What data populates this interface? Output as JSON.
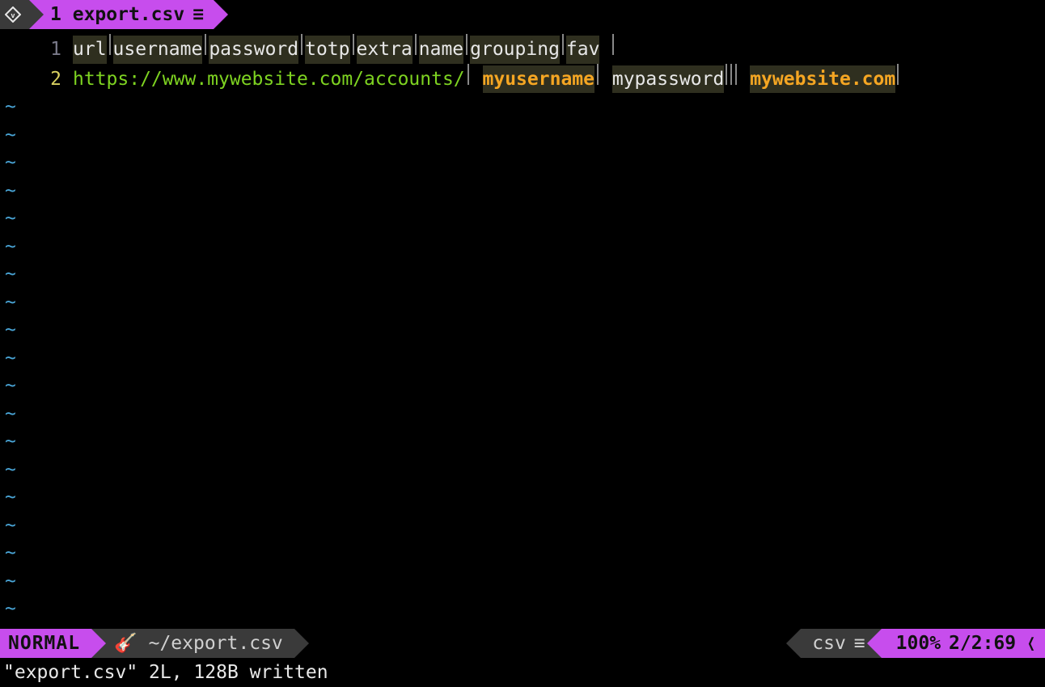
{
  "tab": {
    "index": "1",
    "filename": "export.csv"
  },
  "file": {
    "lines": [
      {
        "num": "1",
        "current": false,
        "cells": [
          {
            "text": "url",
            "cls": "field"
          },
          {
            "text": "username",
            "cls": "field"
          },
          {
            "text": "password",
            "cls": "field"
          },
          {
            "text": "totp",
            "cls": "field"
          },
          {
            "text": "extra",
            "cls": "field"
          },
          {
            "text": "name",
            "cls": "field"
          },
          {
            "text": "grouping",
            "cls": "field"
          },
          {
            "text": "fav",
            "cls": "field",
            "trailing_space": true
          }
        ]
      },
      {
        "num": "2",
        "current": true,
        "cells": [
          {
            "text": "https://www.mywebsite.com/accounts/",
            "cls": "url"
          },
          {
            "text": "myusername",
            "cls": "orange",
            "leading_space": true
          },
          {
            "text": "mypassword",
            "cls": "val",
            "leading_space": true
          },
          {
            "text": "",
            "cls": "val"
          },
          {
            "text": "",
            "cls": "val"
          },
          {
            "text": "mywebsite.com",
            "cls": "orange",
            "leading_space": true
          }
        ]
      }
    ]
  },
  "empty_line_marker": "~",
  "empty_line_count": 19,
  "status": {
    "mode": "NORMAL",
    "branch_icon": "🎸",
    "path": "~/export.csv",
    "filetype": "csv",
    "percent": "100%",
    "linecol": "2/2:69"
  },
  "cmdline": "\"export.csv\" 2L, 128B written"
}
